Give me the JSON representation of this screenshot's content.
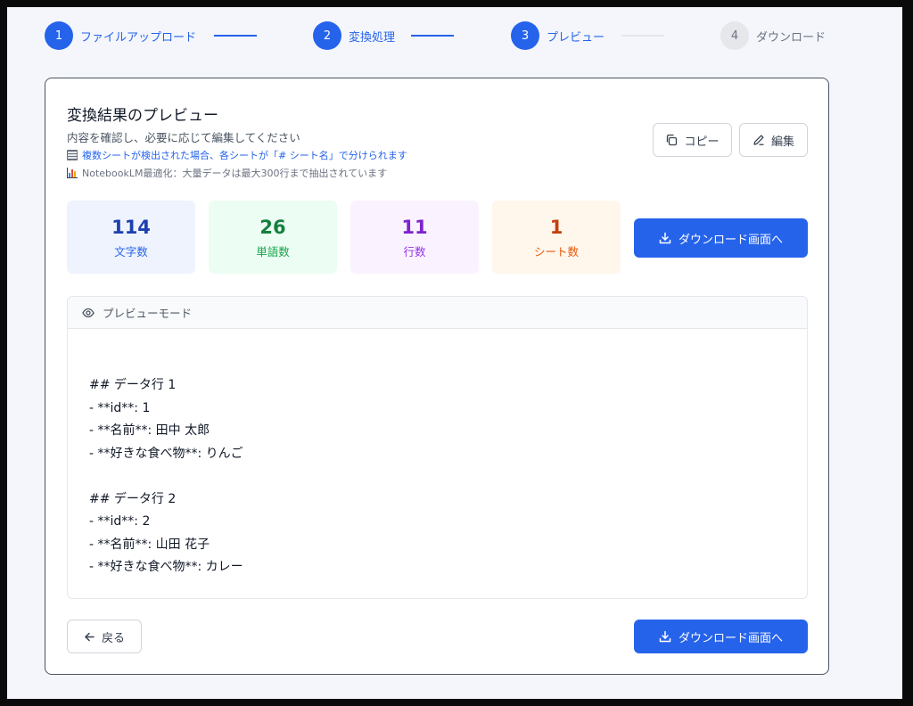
{
  "stepper": {
    "steps": [
      {
        "number": "1",
        "label": "ファイルアップロード"
      },
      {
        "number": "2",
        "label": "変換処理"
      },
      {
        "number": "3",
        "label": "プレビュー"
      },
      {
        "number": "4",
        "label": "ダウンロード"
      }
    ]
  },
  "card": {
    "title": "変換結果のプレビュー",
    "description": "内容を確認し、必要に応じて編集してください",
    "note_multi_sheet": "複数シートが検出された場合、各シートが「# シート名」で分けられます",
    "note_notebooklm": "NotebookLM最適化：大量データは最大300行まで抽出されています",
    "copy_label": "コピー",
    "edit_label": "編集"
  },
  "stats": {
    "chars": {
      "value": "114",
      "label": "文字数"
    },
    "words": {
      "value": "26",
      "label": "単語数"
    },
    "lines": {
      "value": "11",
      "label": "行数"
    },
    "sheets": {
      "value": "1",
      "label": "シート数"
    }
  },
  "download_label": "ダウンロード画面へ",
  "preview": {
    "mode_label": "プレビューモード",
    "lines": [
      "## データ行 1",
      "- **id**: 1",
      "- **名前**: 田中 太郎",
      "- **好きな食べ物**: りんご",
      "",
      "## データ行 2",
      "- **id**: 2",
      "- **名前**: 山田 花子",
      "- **好きな食べ物**: カレー"
    ]
  },
  "back_label": "戻る",
  "colors": {
    "primary": "#2563eb",
    "background": "#f4f6fb",
    "step_inactive": "#e5e7eb"
  }
}
